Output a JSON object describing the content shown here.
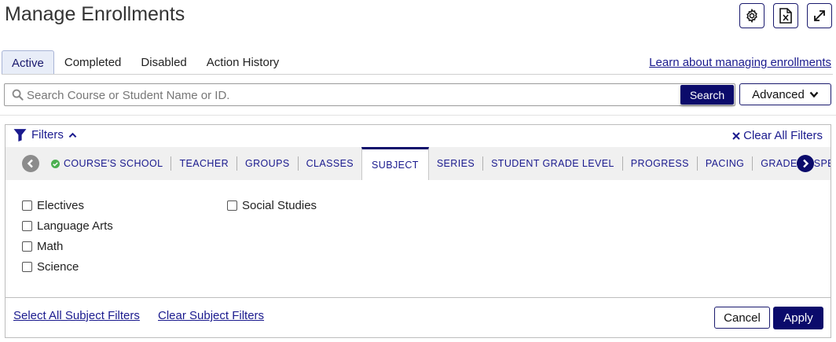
{
  "page": {
    "title": "Manage Enrollments"
  },
  "toolbar": {
    "settings_icon": "gear-icon",
    "export_icon": "excel-file-icon",
    "expand_icon": "expand-arrows-icon"
  },
  "tabs": [
    {
      "label": "Active",
      "active": true
    },
    {
      "label": "Completed",
      "active": false
    },
    {
      "label": "Disabled",
      "active": false
    },
    {
      "label": "Action History",
      "active": false
    }
  ],
  "help_link": "Learn about managing enrollments",
  "search": {
    "placeholder": "Search Course or Student Name or ID.",
    "value": "",
    "button_label": "Search",
    "advanced_label": "Advanced"
  },
  "filters": {
    "header_label": "Filters",
    "clear_all_label": "Clear All Filters",
    "categories": [
      {
        "label": "COURSE'S SCHOOL",
        "applied": true
      },
      {
        "label": "TEACHER"
      },
      {
        "label": "GROUPS"
      },
      {
        "label": "CLASSES"
      },
      {
        "label": "SUBJECT",
        "active": true
      },
      {
        "label": "SERIES"
      },
      {
        "label": "STUDENT GRADE LEVEL"
      },
      {
        "label": "PROGRESS"
      },
      {
        "label": "PACING"
      },
      {
        "label": "GRADE"
      },
      {
        "label": "SPECIA"
      }
    ],
    "options_col1": [
      {
        "label": "Electives",
        "checked": false
      },
      {
        "label": "Language Arts",
        "checked": false
      },
      {
        "label": "Math",
        "checked": false
      },
      {
        "label": "Science",
        "checked": false
      }
    ],
    "options_col2": [
      {
        "label": "Social Studies",
        "checked": false
      }
    ],
    "select_all_label": "Select All Subject Filters",
    "clear_subject_label": "Clear Subject Filters",
    "cancel_label": "Cancel",
    "apply_label": "Apply"
  },
  "colors": {
    "brand": "#0b0b6b",
    "link": "#1a1a8e",
    "success": "#4caf50"
  }
}
